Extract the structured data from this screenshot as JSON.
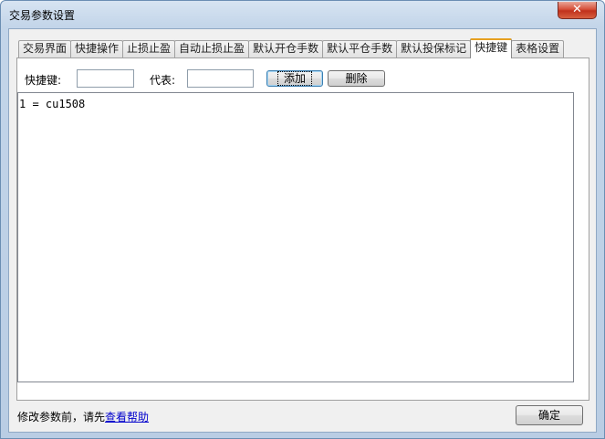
{
  "window": {
    "title": "交易参数设置",
    "close_glyph": "✕"
  },
  "tabs": [
    {
      "label": "交易界面",
      "active": false
    },
    {
      "label": "快捷操作",
      "active": false
    },
    {
      "label": "止损止盈",
      "active": false
    },
    {
      "label": "自动止损止盈",
      "active": false
    },
    {
      "label": "默认开仓手数",
      "active": false
    },
    {
      "label": "默认平仓手数",
      "active": false
    },
    {
      "label": "默认投保标记",
      "active": false
    },
    {
      "label": "快捷键",
      "active": true
    },
    {
      "label": "表格设置",
      "active": false
    }
  ],
  "hotkey_panel": {
    "hotkey_label": "快捷键:",
    "hotkey_value": "",
    "code_label": "代表:",
    "code_value": "",
    "add_label": "添加",
    "delete_label": "删除",
    "items": [
      "1 = cu1508"
    ]
  },
  "footer": {
    "hint_text": "修改参数前，请先",
    "help_link": "查看帮助",
    "ok_label": "确定"
  }
}
